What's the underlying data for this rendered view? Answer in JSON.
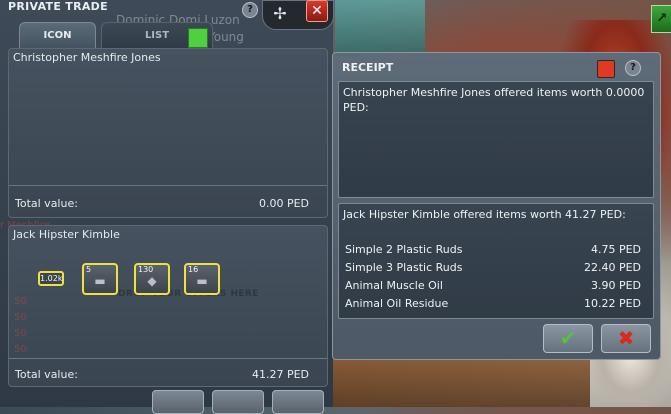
{
  "trade_window": {
    "title": "PRIVATE TRADE",
    "help": "?",
    "partner_name_ghost": "Dominic Domi Luzon",
    "partner_name_ghost2": "Young",
    "tabs": [
      {
        "label": "ICON"
      },
      {
        "label": "LIST"
      }
    ],
    "partner_panel": {
      "name": "Christopher Meshfire Jones",
      "total_label": "Total value:",
      "total_value": "0.00 PED"
    },
    "self_panel": {
      "name": "Jack Hipster Kimble",
      "drop_hint": "DROP YOUR OFFERS HERE",
      "items": [
        {
          "qty": "1.02k",
          "icon": "ammo-icon"
        },
        {
          "qty": "5",
          "icon": "plastic-ruds-icon"
        },
        {
          "qty": "130",
          "icon": "oil-icon"
        },
        {
          "qty": "16",
          "icon": "plastic-ruds-icon"
        }
      ],
      "total_label": "Total value:",
      "total_value": "41.27 PED"
    },
    "colors": {
      "highlight": "#f0e044",
      "accept": "#56c23a",
      "decline": "#d92a1e"
    }
  },
  "receipt": {
    "title": "RECEIPT",
    "help": "?",
    "partner_offer": "Christopher Meshfire Jones offered items worth 0.0000 PED:",
    "self_offer": "Jack Hipster Kimble offered items worth 41.27 PED:",
    "items": [
      {
        "name": "Simple 2 Plastic Ruds",
        "price": "4.75 PED"
      },
      {
        "name": "Simple 3 Plastic Ruds",
        "price": "22.40 PED"
      },
      {
        "name": "Animal Muscle Oil",
        "price": "3.90 PED"
      },
      {
        "name": "Animal Oil Residue",
        "price": "10.22 PED"
      }
    ],
    "accept_icon": "checkmark-icon",
    "decline_icon": "x-icon"
  }
}
